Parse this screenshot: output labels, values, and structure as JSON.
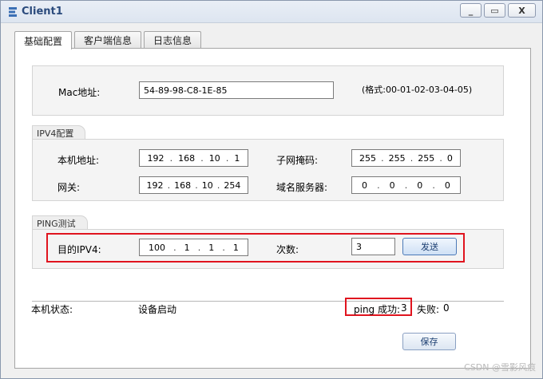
{
  "window": {
    "title": "Client1",
    "minimize": "_",
    "maximize": "▭",
    "close": "X"
  },
  "tabs": [
    {
      "label": "基础配置"
    },
    {
      "label": "客户端信息"
    },
    {
      "label": "日志信息"
    }
  ],
  "mac": {
    "label": "Mac地址:",
    "value": "54-89-98-C8-1E-85",
    "hint": "(格式:00-01-02-03-04-05)"
  },
  "ipv4": {
    "group_title": "IPV4配置",
    "local_ip_label": "本机地址:",
    "local_ip": [
      "192",
      "168",
      "10",
      "1"
    ],
    "subnet_label": "子网掩码:",
    "subnet": [
      "255",
      "255",
      "255",
      "0"
    ],
    "gateway_label": "网关:",
    "gateway": [
      "192",
      "168",
      "10",
      "254"
    ],
    "dns_label": "域名服务器:",
    "dns": [
      "0",
      "0",
      "0",
      "0"
    ]
  },
  "ping": {
    "group_title": "PING测试",
    "dest_label": "目的IPV4:",
    "dest": [
      "100",
      "1",
      "1",
      "1"
    ],
    "count_label": "次数:",
    "count": "3",
    "send_label": "发送"
  },
  "status": {
    "label": "本机状态:",
    "value": "设备启动",
    "success_label": "ping 成功:",
    "success_value": "3",
    "fail_label": "失败:",
    "fail_value": "0"
  },
  "save_label": "保存",
  "watermark": "CSDN @雪影风痕",
  "colors": {
    "highlight_red": "#e0141e",
    "title_blue": "#2a4a7c"
  }
}
